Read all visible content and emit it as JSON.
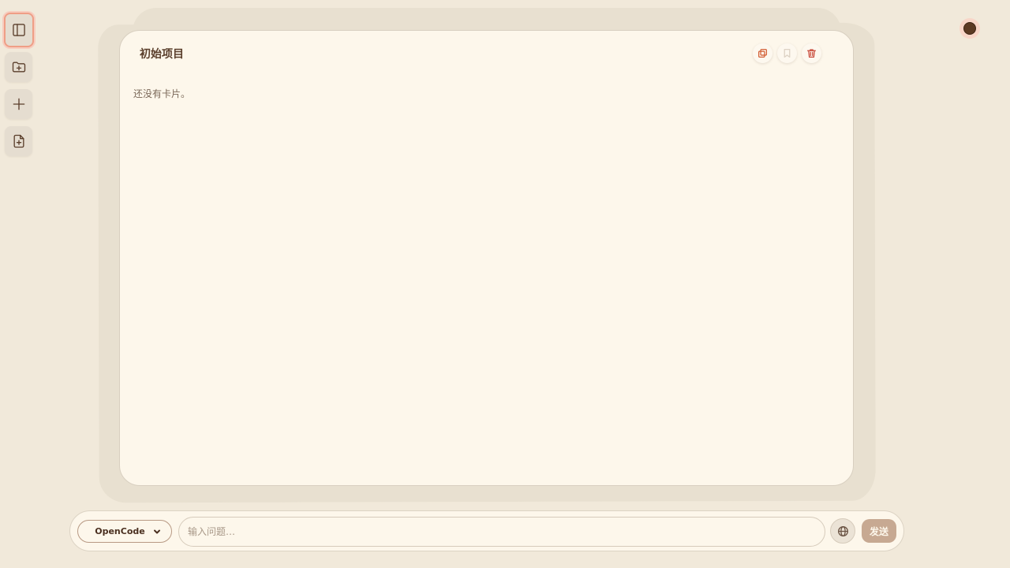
{
  "rail": {
    "items": [
      {
        "name": "sidebar-toggle",
        "icon": "sidebar-icon",
        "active": true
      },
      {
        "name": "new-folder",
        "icon": "folder-plus-icon"
      },
      {
        "name": "add",
        "icon": "plus-icon"
      },
      {
        "name": "new-file",
        "icon": "file-plus-icon"
      }
    ]
  },
  "board": {
    "title": "初始项目",
    "empty_message": "还没有卡片。",
    "actions": [
      {
        "name": "copy",
        "icon": "copy-icon"
      },
      {
        "name": "bookmark",
        "icon": "bookmark-icon"
      },
      {
        "name": "delete",
        "icon": "trash-icon"
      }
    ]
  },
  "composer": {
    "model_label": "OpenCode",
    "input_value": "",
    "input_placeholder": "输入问题…",
    "globe_icon": "globe-icon",
    "send_label": "发送"
  },
  "colors": {
    "background": "#f1e9da",
    "card": "#fdf7eb",
    "accent": "#ef9e86",
    "send": "#c7a992",
    "text": "#5a3e2b"
  }
}
